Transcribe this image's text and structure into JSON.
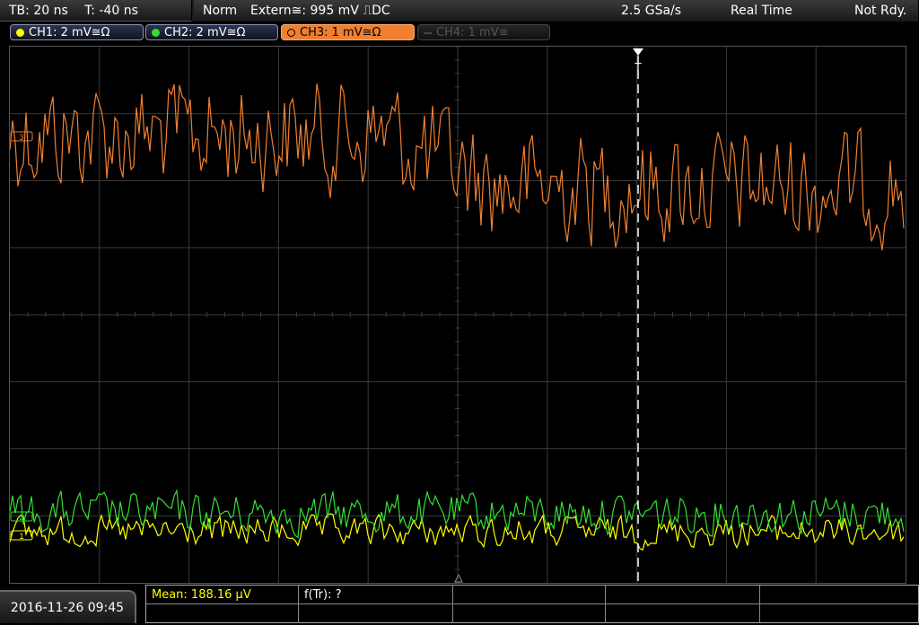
{
  "topbar": {
    "timebase": "TB: 20 ns",
    "trigger_time": "T: -40 ns",
    "mode": "Norm",
    "trigger_source": "Extern≅: 995 mV ⎍DC",
    "sample_rate": "2.5 GSa/s",
    "acq_mode": "Real Time",
    "status": "Not Rdy."
  },
  "channels": [
    {
      "label": "CH1: 2 mV≅Ω",
      "color": "#ffff00",
      "state": "normal"
    },
    {
      "label": "CH2: 2 mV≅Ω",
      "color": "#33e033",
      "state": "normal"
    },
    {
      "label": "CH3: 1 mV≅Ω",
      "color": "#f08030",
      "state": "active"
    },
    {
      "label": "CH4: 1 mV≅",
      "color": "#555555",
      "state": "disabled"
    }
  ],
  "waveform_markers": {
    "ch1": "1",
    "ch2": "2",
    "ch3": "3",
    "trigger": "T"
  },
  "measurements": {
    "mean": "Mean: 188.16 µV",
    "f_tr": "f(Tr): ?"
  },
  "datetime": "2016-11-26 09:45",
  "colors": {
    "ch1": "#ffff00",
    "ch2": "#33e033",
    "ch3": "#f08030",
    "grid": "#3a3a3a"
  }
}
